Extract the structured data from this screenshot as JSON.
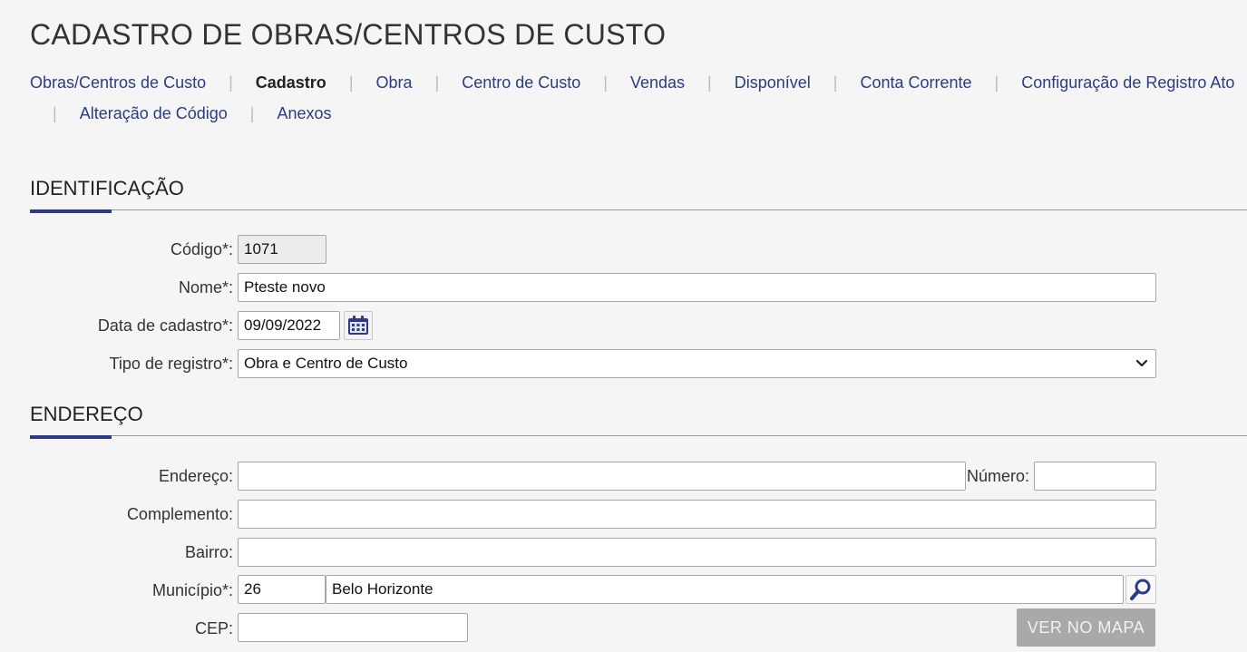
{
  "page": {
    "title": "CADASTRO DE OBRAS/CENTROS DE CUSTO"
  },
  "tabs": [
    {
      "label": "Obras/Centros de Custo",
      "active": false
    },
    {
      "label": "Cadastro",
      "active": true
    },
    {
      "label": "Obra",
      "active": false
    },
    {
      "label": "Centro de Custo",
      "active": false
    },
    {
      "label": "Vendas",
      "active": false
    },
    {
      "label": "Disponível",
      "active": false
    },
    {
      "label": "Conta Corrente",
      "active": false
    },
    {
      "label": "Configuração de Registro Ato",
      "active": false
    },
    {
      "label": "Alteração de Código",
      "active": false
    },
    {
      "label": "Anexos",
      "active": false
    }
  ],
  "tab_separator": "|",
  "identificacao": {
    "title": "IDENTIFICAÇÃO",
    "codigo": {
      "label": "Código*:",
      "value": "1071"
    },
    "nome": {
      "label": "Nome*:",
      "value": "Pteste novo"
    },
    "data_cadastro": {
      "label": "Data de cadastro*:",
      "value": "09/09/2022"
    },
    "tipo_registro": {
      "label": "Tipo de registro*:",
      "value": "Obra e Centro de Custo"
    }
  },
  "endereco": {
    "title": "ENDEREÇO",
    "endereco": {
      "label": "Endereço:",
      "value": ""
    },
    "numero": {
      "label": "Número:",
      "value": ""
    },
    "complemento": {
      "label": "Complemento:",
      "value": ""
    },
    "bairro": {
      "label": "Bairro:",
      "value": ""
    },
    "municipio": {
      "label": "Município*:",
      "code": "26",
      "name": "Belo Horizonte"
    },
    "cep": {
      "label": "CEP:",
      "value": ""
    },
    "map_button": "VER NO MAPA"
  },
  "colors": {
    "accent": "#2c3a87",
    "link": "#2c3a87",
    "disabled_button": "#a9a9a9"
  },
  "icons": {
    "calendar": "calendar-icon",
    "search": "search-icon",
    "select": "chevron-down-icon"
  }
}
